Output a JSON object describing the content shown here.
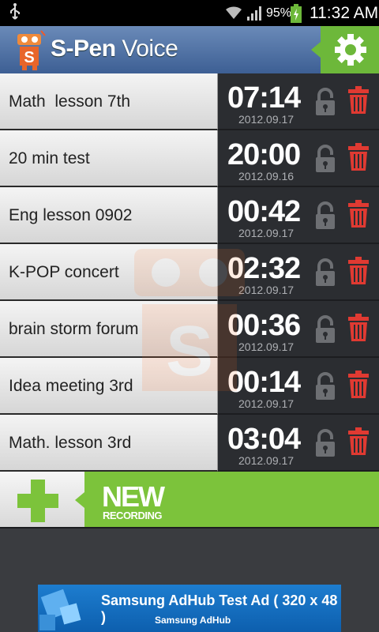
{
  "status_bar": {
    "battery_percent": "95%",
    "clock": "11:32 AM"
  },
  "header": {
    "title_bold": "S-Pen",
    "title_light": " Voice"
  },
  "recordings": [
    {
      "name": "Math  lesson 7th",
      "duration": "07:14",
      "date": "2012.09.17"
    },
    {
      "name": "20 min test",
      "duration": "20:00",
      "date": "2012.09.16"
    },
    {
      "name": "Eng lesson 0902",
      "duration": "00:42",
      "date": "2012.09.17"
    },
    {
      "name": "K-POP concert",
      "duration": "02:32",
      "date": "2012.09.17"
    },
    {
      "name": "brain storm forum",
      "duration": "00:36",
      "date": "2012.09.17"
    },
    {
      "name": "Idea meeting 3rd",
      "duration": "00:14",
      "date": "2012.09.17"
    },
    {
      "name": "Math. lesson 3rd",
      "duration": "03:04",
      "date": "2012.09.17"
    }
  ],
  "new_recording": {
    "line1": "NEW",
    "line2": "RECORDING"
  },
  "ad": {
    "title": "Samsung AdHub Test Ad ( 320 x 48 )",
    "brand": "Samsung AdHub"
  },
  "colors": {
    "accent_green": "#7cc33b",
    "header_blue": "#4a6ea3",
    "trash_red": "#e03a32",
    "row_dark": "#2b2d31"
  },
  "icons": [
    "usb-icon",
    "wifi-icon",
    "signal-icon",
    "battery-icon",
    "app-logo-icon",
    "gear-icon",
    "lock-icon",
    "trash-icon",
    "plus-icon"
  ]
}
